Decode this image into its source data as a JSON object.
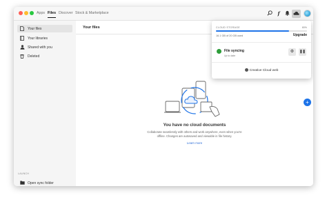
{
  "topnav": {
    "items": [
      "Apps",
      "Files",
      "Discover",
      "Stock & Marketplace"
    ],
    "active": "Files"
  },
  "icons": {
    "search": "search-icon",
    "fonts": "fonts-icon",
    "notifications": "bell-icon",
    "cloud": "cloud-icon",
    "avatar": "avatar"
  },
  "sidebar": {
    "items": [
      {
        "label": "Your files",
        "icon": "file-icon",
        "active": true
      },
      {
        "label": "Your libraries",
        "icon": "library-icon",
        "active": false
      },
      {
        "label": "Shared with you",
        "icon": "shared-icon",
        "active": false
      },
      {
        "label": "Deleted",
        "icon": "trash-icon",
        "active": false
      }
    ],
    "launch_label": "LAUNCH",
    "open_sync_folder": "Open sync folder"
  },
  "main": {
    "title": "Your files",
    "empty_title": "You have no cloud documents",
    "empty_desc": "Collaborate seamlessly with others and work anywhere, even when you're offline. Changes are autosaved and viewable in file history.",
    "learn_more": "Learn more"
  },
  "cloud_popover": {
    "storage_label": "CLOUD STORAGE",
    "percent_text": "80%",
    "usage_fraction": 0.8,
    "used_text": "16.1 GB of 20 GB used",
    "upgrade": "Upgrade",
    "sync_title": "File syncing",
    "sync_status": "Up to date",
    "web_link": "Creative Cloud web"
  },
  "colors": {
    "accent": "#1d73e8",
    "success": "#2d9d3a"
  }
}
